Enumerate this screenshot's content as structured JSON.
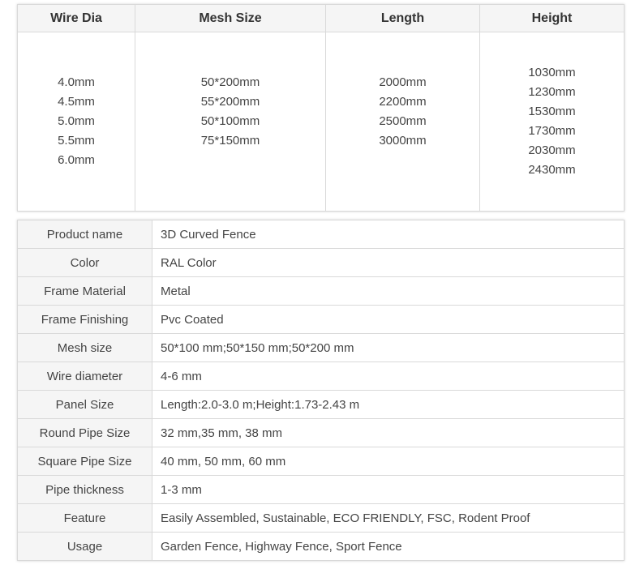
{
  "spec_table": {
    "headers": [
      "Wire Dia",
      "Mesh Size",
      "Length",
      "Height"
    ],
    "columns": [
      [
        "4.0mm",
        "4.5mm",
        "5.0mm",
        "5.5mm",
        "6.0mm"
      ],
      [
        "50*200mm",
        "55*200mm",
        "50*100mm",
        "75*150mm"
      ],
      [
        "2000mm",
        "2200mm",
        "2500mm",
        "3000mm"
      ],
      [
        "1030mm",
        "1230mm",
        "1530mm",
        "1730mm",
        "2030mm",
        "2430mm"
      ]
    ]
  },
  "properties": [
    {
      "key": "Product name",
      "value": "3D Curved Fence"
    },
    {
      "key": "Color",
      "value": "RAL Color"
    },
    {
      "key": "Frame Material",
      "value": "Metal"
    },
    {
      "key": "Frame Finishing",
      "value": "Pvc Coated"
    },
    {
      "key": "Mesh size",
      "value": "50*100 mm;50*150 mm;50*200 mm"
    },
    {
      "key": "Wire diameter",
      "value": "4-6 mm"
    },
    {
      "key": "Panel Size",
      "value": "Length:2.0-3.0 m;Height:1.73-2.43 m"
    },
    {
      "key": "Round Pipe Size",
      "value": "32 mm,35 mm, 38 mm"
    },
    {
      "key": "Square Pipe Size",
      "value": "40 mm, 50 mm, 60 mm"
    },
    {
      "key": "Pipe thickness",
      "value": "1-3 mm"
    },
    {
      "key": "Feature",
      "value": "Easily Assembled, Sustainable, ECO FRIENDLY, FSC, Rodent Proof"
    },
    {
      "key": "Usage",
      "value": "Garden Fence, Highway Fence, Sport Fence"
    }
  ]
}
